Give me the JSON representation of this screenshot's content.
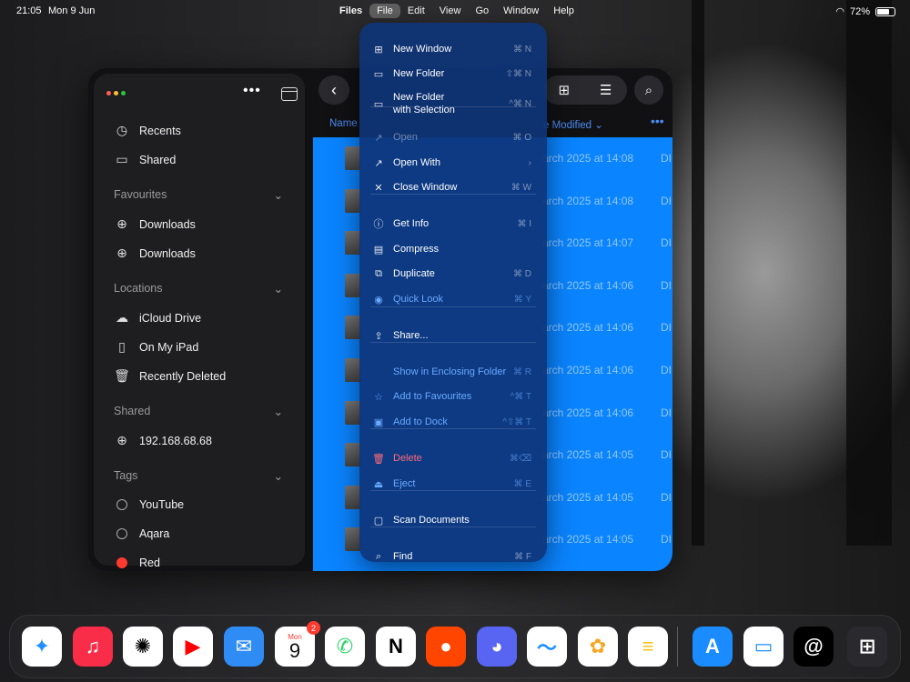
{
  "status_bar": {
    "time": "21:05",
    "date": "Mon 9 Jun",
    "battery": "72%",
    "battery_level": 0.72
  },
  "menubar": {
    "app_name": "Files",
    "menus": [
      "File",
      "Edit",
      "View",
      "Go",
      "Window",
      "Help"
    ],
    "active_menu": "File"
  },
  "sidebar": {
    "top_items": [
      {
        "label": "Recents",
        "icon": "clock-icon"
      },
      {
        "label": "Shared",
        "icon": "shared-folder-icon"
      }
    ],
    "sections": [
      {
        "title": "Favourites",
        "items": [
          {
            "label": "Downloads",
            "icon": "download-icon"
          },
          {
            "label": "Downloads",
            "icon": "download-icon"
          }
        ]
      },
      {
        "title": "Locations",
        "items": [
          {
            "label": "iCloud Drive",
            "icon": "cloud-icon"
          },
          {
            "label": "On My iPad",
            "icon": "ipad-icon"
          },
          {
            "label": "Recently Deleted",
            "icon": "trash-icon"
          }
        ]
      },
      {
        "title": "Shared",
        "items": [
          {
            "label": "192.168.68.68",
            "icon": "globe-icon"
          }
        ]
      },
      {
        "title": "Tags",
        "items": [
          {
            "label": "YouTube",
            "icon": "tag-empty-icon"
          },
          {
            "label": "Aqara",
            "icon": "tag-empty-icon"
          },
          {
            "label": "Red",
            "icon": "tag-red-icon",
            "color": "#ff3b30"
          }
        ]
      }
    ]
  },
  "file_list": {
    "column_name": "Name",
    "column_date": "e Modified",
    "rows": [
      {
        "date": "arch 2025 at 14:08",
        "kind": "DI"
      },
      {
        "date": "arch 2025 at 14:08",
        "kind": "DI"
      },
      {
        "date": "arch 2025 at 14:07",
        "kind": "DI"
      },
      {
        "date": "arch 2025 at 14:06",
        "kind": "DI"
      },
      {
        "date": "arch 2025 at 14:06",
        "kind": "DI"
      },
      {
        "date": "arch 2025 at 14:06",
        "kind": "DI"
      },
      {
        "date": "arch 2025 at 14:06",
        "kind": "DI"
      },
      {
        "date": "arch 2025 at 14:05",
        "kind": "DI"
      },
      {
        "date": "arch 2025 at 14:05",
        "kind": "DI"
      },
      {
        "date": "arch 2025 at 14:05",
        "kind": "DI"
      }
    ]
  },
  "file_menu": {
    "items": [
      {
        "label": "New Window",
        "shortcut": "⌘ N",
        "icon": "new-window-icon",
        "state": "normal"
      },
      {
        "label": "New Folder",
        "shortcut": "⇧⌘ N",
        "icon": "new-folder-icon",
        "state": "normal"
      },
      {
        "label": "New Folder",
        "label2": "with Selection",
        "shortcut": "^⌘ N",
        "icon": "new-folder-selection-icon",
        "state": "normal"
      },
      {
        "label": "Open",
        "shortcut": "⌘ O",
        "icon": "open-icon",
        "state": "disabled"
      },
      {
        "label": "Open With",
        "shortcut": "›",
        "icon": "open-with-icon",
        "state": "normal"
      },
      {
        "label": "Close Window",
        "shortcut": "⌘ W",
        "icon": "close-icon",
        "state": "normal"
      },
      {
        "label": "Get Info",
        "shortcut": "⌘ I",
        "icon": "info-icon",
        "state": "normal"
      },
      {
        "label": "Compress",
        "shortcut": "",
        "icon": "compress-icon",
        "state": "normal"
      },
      {
        "label": "Duplicate",
        "shortcut": "⌘ D",
        "icon": "duplicate-icon",
        "state": "normal"
      },
      {
        "label": "Quick Look",
        "shortcut": "⌘ Y",
        "icon": "eye-icon",
        "state": "blue"
      },
      {
        "label": "Share...",
        "shortcut": "",
        "icon": "share-icon",
        "state": "normal"
      },
      {
        "label": "Show in Enclosing Folder",
        "shortcut": "⌘ R",
        "icon": "",
        "state": "blue"
      },
      {
        "label": "Add to Favourites",
        "shortcut": "^⌘ T",
        "icon": "star-icon",
        "state": "blue"
      },
      {
        "label": "Add to Dock",
        "shortcut": "^⇧⌘ T",
        "icon": "dock-icon",
        "state": "blue"
      },
      {
        "label": "Delete",
        "shortcut": "⌘⌫",
        "icon": "trash-icon",
        "state": "red"
      },
      {
        "label": "Eject",
        "shortcut": "⌘ E",
        "icon": "eject-icon",
        "state": "blue"
      },
      {
        "label": "Scan Documents",
        "shortcut": "",
        "icon": "scan-icon",
        "state": "normal"
      },
      {
        "label": "Find",
        "shortcut": "⌘ F",
        "icon": "search-icon",
        "state": "normal"
      }
    ]
  },
  "dock": {
    "apps": [
      {
        "name": "Safari",
        "icon": "safari-icon",
        "color": "#ffffff"
      },
      {
        "name": "Music",
        "icon": "music-icon",
        "color": "#fa2d48"
      },
      {
        "name": "ChatGPT",
        "icon": "chatgpt-icon",
        "color": "#ffffff"
      },
      {
        "name": "YouTube",
        "icon": "youtube-icon",
        "color": "#ffffff"
      },
      {
        "name": "Mail",
        "icon": "mail-icon",
        "color": "#2f8cf5"
      },
      {
        "name": "Calendar",
        "icon": "calendar-icon",
        "color": "#ffffff",
        "day_label": "Mon",
        "day_number": "9",
        "badge": "2"
      },
      {
        "name": "WhatsApp",
        "icon": "whatsapp-icon",
        "color": "#ffffff"
      },
      {
        "name": "Notion",
        "icon": "notion-icon",
        "color": "#ffffff"
      },
      {
        "name": "Reddit",
        "icon": "reddit-icon",
        "color": "#ff4500"
      },
      {
        "name": "Discord",
        "icon": "discord-icon",
        "color": "#5865f2"
      },
      {
        "name": "Freeform",
        "icon": "freeform-icon",
        "color": "#ffffff"
      },
      {
        "name": "Photos",
        "icon": "photos-icon",
        "color": "#ffffff"
      },
      {
        "name": "Notes",
        "icon": "notes-icon",
        "color": "#ffffff"
      },
      {
        "name": "App Store",
        "icon": "app-store-icon",
        "color": "#1a8cff"
      },
      {
        "name": "Files",
        "icon": "files-icon",
        "color": "#ffffff"
      },
      {
        "name": "Threads",
        "icon": "threads-icon",
        "color": "#000000"
      },
      {
        "name": "App Library",
        "icon": "app-library-icon",
        "color": "#2a2a2e"
      }
    ]
  }
}
